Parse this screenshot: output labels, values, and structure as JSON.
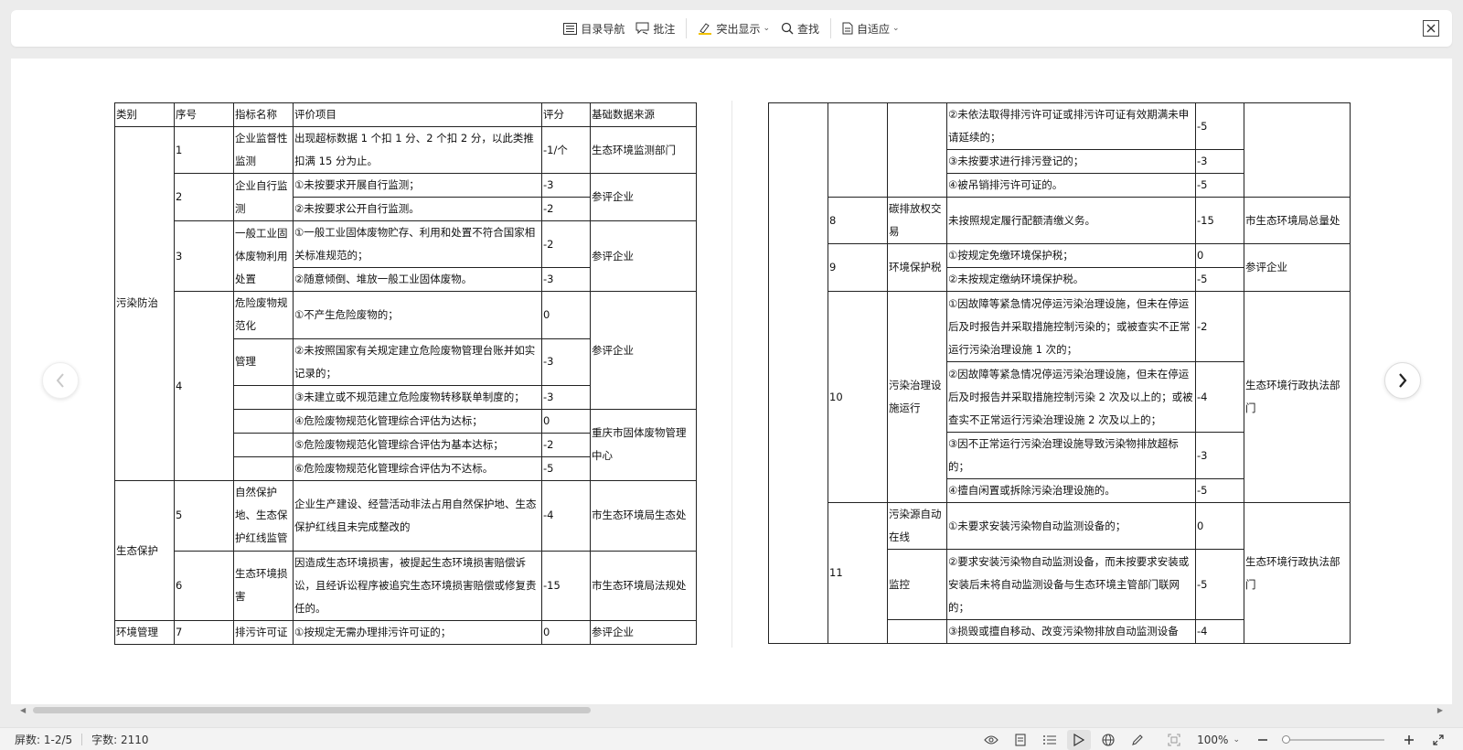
{
  "toolbar": {
    "toc_label": "目录导航",
    "comment_label": "批注",
    "highlight_label": "突出显示",
    "find_label": "查找",
    "fit_label": "自适应"
  },
  "left_table": {
    "header": [
      "类别",
      "序号",
      "指标名称",
      "评价项目",
      "评分",
      "基础数据来源"
    ],
    "cat_pollution": "污染防治",
    "cat_ecology": "生态保护",
    "cat_env_mgmt": "环境管理",
    "rows": {
      "r1": {
        "no": "1",
        "name": "企业监督性监测",
        "item": "出现超标数据 1 个扣 1 分、2 个扣 2 分，以此类推扣满 15 分为止。",
        "score": "-1/个",
        "source": "生态环境监测部门"
      },
      "r2": {
        "no": "2",
        "name": "企业自行监测",
        "item_a": "①未按要求开展自行监测；",
        "score_a": "-3",
        "item_b": "②未按要求公开自行监测。",
        "score_b": "-2",
        "source": "参评企业"
      },
      "r3": {
        "no": "3",
        "name": "一般工业固体废物利用处置",
        "item_a": "①一般工业固体废物贮存、利用和处置不符合国家相关标准规范的；",
        "score_a": "-2",
        "item_b": "②随意倾倒、堆放一般工业固体废物。",
        "score_b": "-3",
        "source": "参评企业"
      },
      "r4": {
        "no": "4",
        "name_a": "危险废物规范化",
        "name_b": "管理",
        "item_1": "①不产生危险废物的；",
        "score_1": "0",
        "item_2": "②未按照国家有关规定建立危险废物管理台账并如实记录的；",
        "score_2": "-3",
        "item_3": "③未建立或不规范建立危险废物转移联单制度的；",
        "score_3": "-3",
        "item_4": "④危险废物规范化管理综合评估为达标；",
        "score_4": "0",
        "item_5": "⑤危险废物规范化管理综合评估为基本达标；",
        "score_5": "-2",
        "item_6": "⑥危险废物规范化管理综合评估为不达标。",
        "score_6": "-5",
        "source_a": "参评企业",
        "source_b": "重庆市固体废物管理中心"
      },
      "r5": {
        "no": "5",
        "name": "自然保护地、生态保护红线监管",
        "item": "企业生产建设、经营活动非法占用自然保护地、生态保护红线且未完成整改的",
        "score": "-4",
        "source": "市生态环境局生态处"
      },
      "r6": {
        "no": "6",
        "name": "生态环境损害",
        "item": "因造成生态环境损害，被提起生态环境损害赔偿诉讼，且经诉讼程序被追究生态环境损害赔偿或修复责任的。",
        "score": "-15",
        "source": "市生态环境局法规处"
      },
      "r7": {
        "no": "7",
        "name": "排污许可证",
        "item": "①按规定无需办理排污许可证的；",
        "score": "0",
        "source": "参评企业"
      }
    }
  },
  "right_table": {
    "c1": {
      "item_2": "②未依法取得排污许可证或排污许可证有效期满未申请延续的；",
      "score_2": "-5",
      "item_3": "③未按要求进行排污登记的；",
      "score_3": "-3",
      "item_4": "④被吊销排污许可证的。",
      "score_4": "-5"
    },
    "r8": {
      "no": "8",
      "name": "碳排放权交易",
      "item": "未按照规定履行配额清缴义务。",
      "score": "-15",
      "source": "市生态环境局总量处"
    },
    "r9": {
      "no": "9",
      "name": "环境保护税",
      "item_a": "①按规定免缴环境保护税；",
      "score_a": "0",
      "item_b": "②未按规定缴纳环境保护税。",
      "score_b": "-5",
      "source": "参评企业"
    },
    "r10": {
      "no": "10",
      "name": "污染治理设施运行",
      "item_1": "①因故障等紧急情况停运污染治理设施，但未在停运后及时报告并采取措施控制污染的；或被查实不正常运行污染治理设施 1 次的；",
      "score_1": "-2",
      "item_2": "②因故障等紧急情况停运污染治理设施，但未在停运后及时报告并采取措施控制污染 2 次及以上的；或被查实不正常运行污染治理设施 2 次及以上的；",
      "score_2": "-4",
      "item_3": "③因不正常运行污染治理设施导致污染物排放超标的；",
      "score_3": "-3",
      "item_4": "④擅自闲置或拆除污染治理设施的。",
      "score_4": "-5",
      "source": "生态环境行政执法部门"
    },
    "r11": {
      "no": "11",
      "name_a": "污染源自动在线",
      "name_b": "监控",
      "item_1": "①未要求安装污染物自动监测设备的；",
      "score_1": "0",
      "item_2": "②要求安装污染物自动监测设备，而未按要求安装或安装后未将自动监测设备与生态环境主管部门联网的；",
      "score_2": "-5",
      "item_3": "③损毁或擅自移动、改变污染物排放自动监测设备",
      "score_3": "-4",
      "source": "生态环境行政执法部门"
    }
  },
  "statusbar": {
    "screens": "屏数: 1-2/5",
    "words": "字数: 2110",
    "zoom": "100%"
  },
  "icons": [
    "toc-icon",
    "comment-icon",
    "highlight-icon",
    "search-icon",
    "fit-page-icon",
    "close-icon",
    "chevron-left-icon",
    "chevron-right-icon",
    "eye-icon",
    "page-view-icon",
    "outline-icon",
    "play-icon",
    "globe-icon",
    "pen-icon",
    "fullscreen-fit-icon",
    "zoom-out-icon",
    "zoom-in-icon",
    "expand-icon"
  ]
}
